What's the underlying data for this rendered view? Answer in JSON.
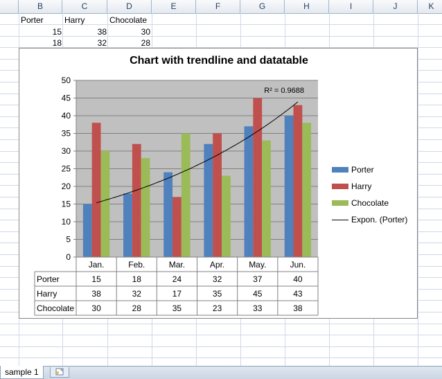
{
  "spreadsheet": {
    "columns": [
      "B",
      "C",
      "D",
      "E",
      "F",
      "G",
      "H",
      "I",
      "J",
      "K"
    ],
    "rows": [
      [
        "Porter",
        "Harry",
        "Chocolate"
      ],
      [
        "15",
        "38",
        "30"
      ],
      [
        "18",
        "32",
        "28"
      ]
    ]
  },
  "sheet_tab": {
    "label": "sample 1"
  },
  "chart_data": {
    "type": "bar",
    "title": "Chart with trendline and datatable",
    "categories": [
      "Jan.",
      "Feb.",
      "Mar.",
      "Apr.",
      "May.",
      "Jun."
    ],
    "series": [
      {
        "name": "Porter",
        "color": "#4f81bd",
        "values": [
          15,
          18,
          24,
          32,
          37,
          40
        ]
      },
      {
        "name": "Harry",
        "color": "#c0504d",
        "values": [
          38,
          32,
          17,
          35,
          45,
          43
        ]
      },
      {
        "name": "Chocolate",
        "color": "#9bbb59",
        "values": [
          30,
          28,
          35,
          23,
          33,
          38
        ]
      }
    ],
    "ylim": [
      0,
      50
    ],
    "yticks": [
      "0",
      "5",
      "10",
      "15",
      "20",
      "25",
      "30",
      "35",
      "40",
      "45",
      "50"
    ],
    "grid": true,
    "plot_background": "#c0c0c0",
    "trendline": {
      "name": "Expon. (Porter)",
      "type": "exponential",
      "series": "Porter",
      "r2_label": "R² = 0.9688"
    },
    "legend_position": "right",
    "data_table": true
  }
}
